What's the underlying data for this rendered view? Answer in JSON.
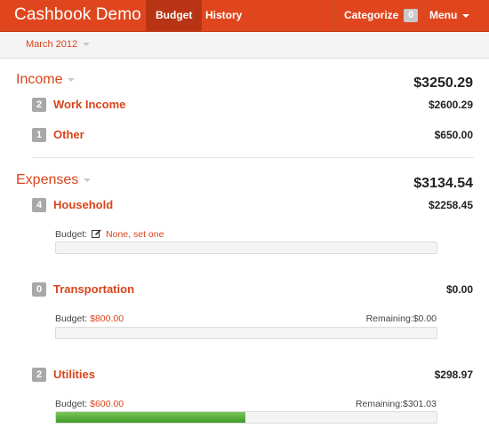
{
  "header": {
    "brand": "Cashbook Demo",
    "tabs": [
      {
        "label": "Budget",
        "active": true
      },
      {
        "label": "History",
        "active": false
      }
    ],
    "categorize_label": "Categorize",
    "categorize_count": "0",
    "menu_label": "Menu"
  },
  "subbar": {
    "month": "March 2012"
  },
  "income": {
    "title": "Income",
    "total": "$3250.29",
    "categories": [
      {
        "count": "2",
        "name": "Work Income",
        "amount": "$2600.29"
      },
      {
        "count": "1",
        "name": "Other",
        "amount": "$650.00"
      }
    ]
  },
  "expenses": {
    "title": "Expenses",
    "total": "$3134.54",
    "categories": [
      {
        "count": "4",
        "name": "Household",
        "amount": "$2258.45",
        "budget_label": "Budget:",
        "budget_value": "None, set one",
        "progress": 0
      },
      {
        "count": "0",
        "name": "Transportation",
        "amount": "$0.00",
        "budget_label": "Budget:",
        "budget_value": "$800.00",
        "remaining_label": "Remaining:",
        "remaining_value": "$0.00",
        "progress": 0
      },
      {
        "count": "2",
        "name": "Utilities",
        "amount": "$298.97",
        "budget_label": "Budget:",
        "budget_value": "$600.00",
        "remaining_label": "Remaining:",
        "remaining_value": "$301.03",
        "progress": 0.498
      }
    ]
  },
  "colors": {
    "accent": "#e0461e",
    "link": "#d9441b",
    "progress": "#4fa832"
  },
  "icons": {
    "edit": "edit-icon",
    "dropdown": "caret-down-icon"
  }
}
